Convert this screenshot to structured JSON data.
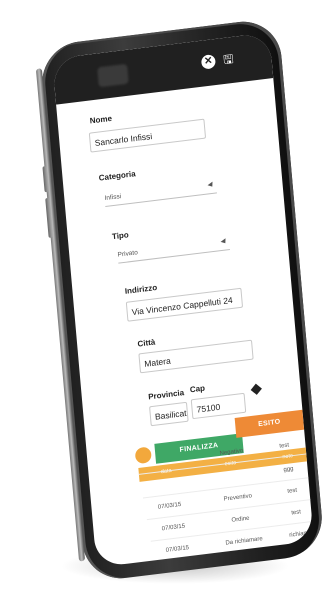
{
  "form": {
    "nome": {
      "label": "Nome",
      "value": "Sancarlo Infissi"
    },
    "categoria": {
      "label": "Categoria",
      "value": "Infissi"
    },
    "tipo": {
      "label": "Tipo",
      "value": "Privato"
    },
    "indirizzo": {
      "label": "Indirizzo",
      "value": "Via Vincenzo Cappelluti 24"
    },
    "citta": {
      "label": "Città",
      "value": "Matera"
    },
    "provincia": {
      "label": "Provincia",
      "value": "Basilicata"
    },
    "cap": {
      "label": "Cap",
      "value": "75100"
    }
  },
  "actions": {
    "finalizza": "FINALIZZA",
    "esito": "ESITO"
  },
  "table": {
    "headers": [
      "data",
      "esito",
      "note"
    ],
    "rows": [
      {
        "date": "",
        "outcome": "Negativo",
        "note": "test"
      },
      {
        "date": "",
        "outcome": "",
        "note": "ggg"
      },
      {
        "date": "07/03/15",
        "outcome": "Preventivo",
        "note": "test"
      },
      {
        "date": "07/03/15",
        "outcome": "Ordine",
        "note": "test"
      },
      {
        "date": "07/03/15",
        "outcome": "Da richiamare",
        "note": "richiama"
      }
    ]
  },
  "icons": {
    "close": "close-icon",
    "save": "save-icon",
    "navigate": "navigate-icon"
  },
  "colors": {
    "green": "#3fa866",
    "orange": "#ee8a36",
    "table_header": "#f3b044"
  }
}
